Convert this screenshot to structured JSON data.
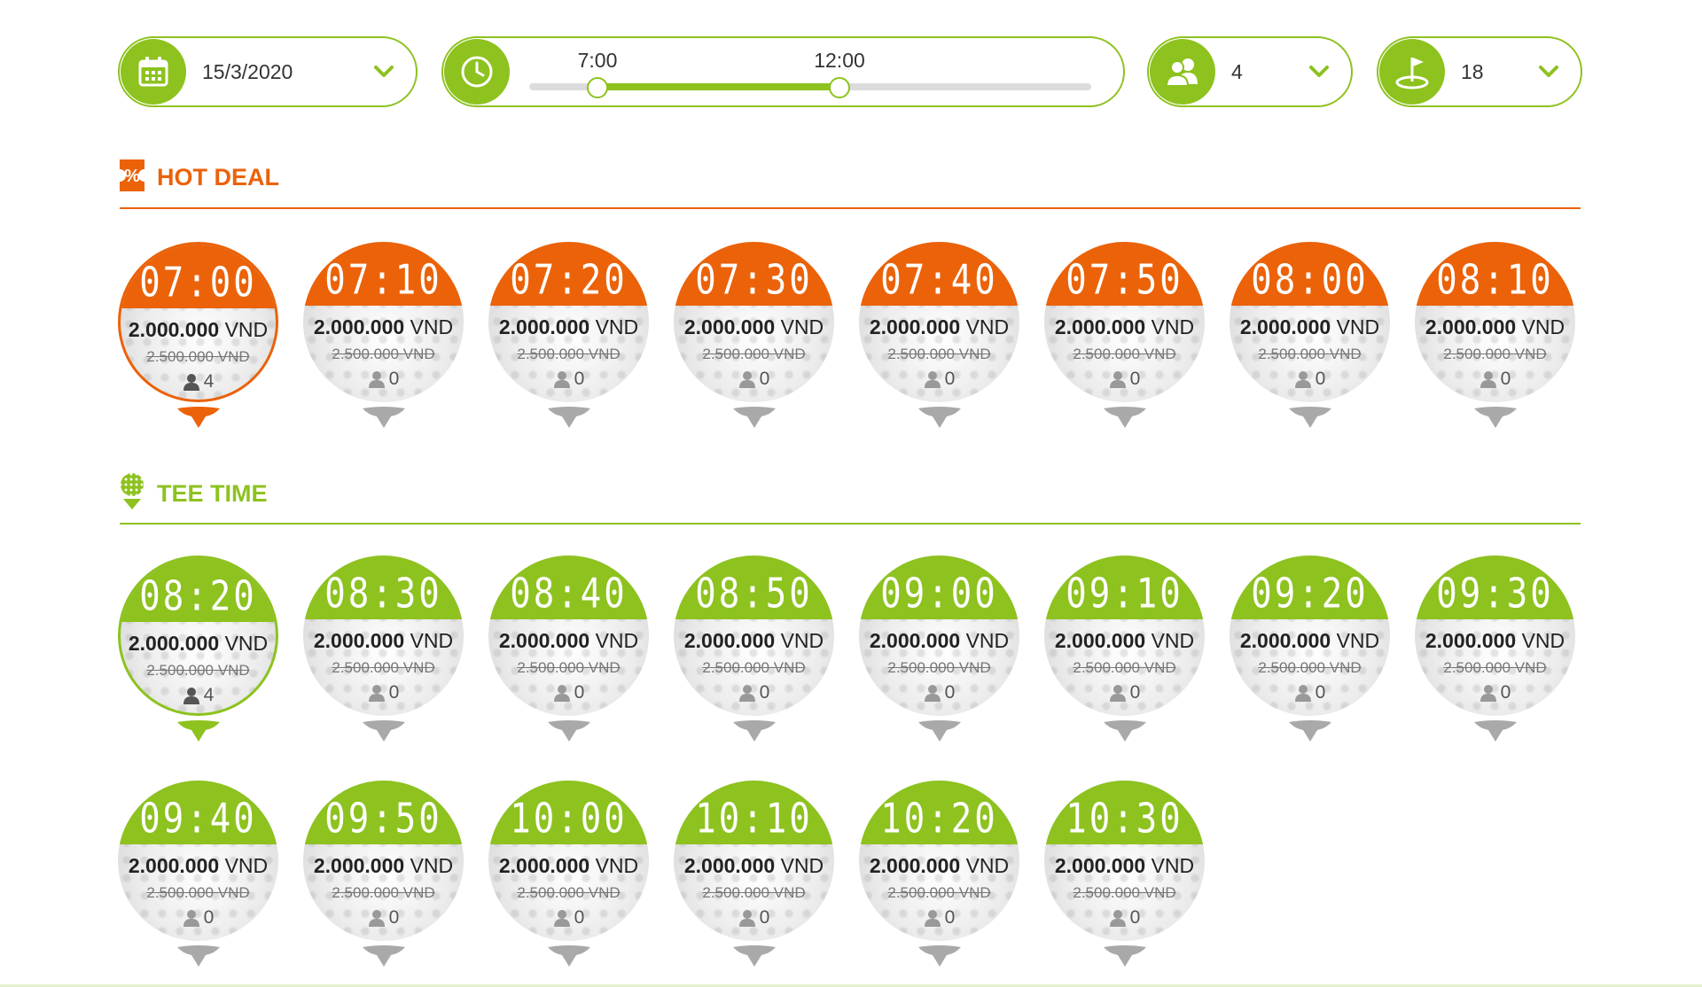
{
  "filters": {
    "date": "15/3/2020",
    "time_from": "7:00",
    "time_to": "12:00",
    "players": "4",
    "holes": "18"
  },
  "hot_deal": {
    "title": "HOT DEAL",
    "color": "#eb6209",
    "slots": [
      {
        "time": "07:00",
        "price": "2.000.000",
        "currency": "VND",
        "old_price": "2.500.000 VND",
        "players": "4",
        "selected": true
      },
      {
        "time": "07:10",
        "price": "2.000.000",
        "currency": "VND",
        "old_price": "2.500.000 VND",
        "players": "0",
        "selected": false
      },
      {
        "time": "07:20",
        "price": "2.000.000",
        "currency": "VND",
        "old_price": "2.500.000 VND",
        "players": "0",
        "selected": false
      },
      {
        "time": "07:30",
        "price": "2.000.000",
        "currency": "VND",
        "old_price": "2.500.000 VND",
        "players": "0",
        "selected": false
      },
      {
        "time": "07:40",
        "price": "2.000.000",
        "currency": "VND",
        "old_price": "2.500.000 VND",
        "players": "0",
        "selected": false
      },
      {
        "time": "07:50",
        "price": "2.000.000",
        "currency": "VND",
        "old_price": "2.500.000 VND",
        "players": "0",
        "selected": false
      },
      {
        "time": "08:00",
        "price": "2.000.000",
        "currency": "VND",
        "old_price": "2.500.000 VND",
        "players": "0",
        "selected": false
      },
      {
        "time": "08:10",
        "price": "2.000.000",
        "currency": "VND",
        "old_price": "2.500.000 VND",
        "players": "0",
        "selected": false
      }
    ]
  },
  "tee_time": {
    "title": "TEE TIME",
    "color": "#8dc21f",
    "slots": [
      {
        "time": "08:20",
        "price": "2.000.000",
        "currency": "VND",
        "old_price": "2.500.000 VND",
        "players": "4",
        "selected": true
      },
      {
        "time": "08:30",
        "price": "2.000.000",
        "currency": "VND",
        "old_price": "2.500.000 VND",
        "players": "0",
        "selected": false
      },
      {
        "time": "08:40",
        "price": "2.000.000",
        "currency": "VND",
        "old_price": "2.500.000 VND",
        "players": "0",
        "selected": false
      },
      {
        "time": "08:50",
        "price": "2.000.000",
        "currency": "VND",
        "old_price": "2.500.000 VND",
        "players": "0",
        "selected": false
      },
      {
        "time": "09:00",
        "price": "2.000.000",
        "currency": "VND",
        "old_price": "2.500.000 VND",
        "players": "0",
        "selected": false
      },
      {
        "time": "09:10",
        "price": "2.000.000",
        "currency": "VND",
        "old_price": "2.500.000 VND",
        "players": "0",
        "selected": false
      },
      {
        "time": "09:20",
        "price": "2.000.000",
        "currency": "VND",
        "old_price": "2.500.000 VND",
        "players": "0",
        "selected": false
      },
      {
        "time": "09:30",
        "price": "2.000.000",
        "currency": "VND",
        "old_price": "2.500.000 VND",
        "players": "0",
        "selected": false
      },
      {
        "time": "09:40",
        "price": "2.000.000",
        "currency": "VND",
        "old_price": "2.500.000 VND",
        "players": "0",
        "selected": false
      },
      {
        "time": "09:50",
        "price": "2.000.000",
        "currency": "VND",
        "old_price": "2.500.000 VND",
        "players": "0",
        "selected": false
      },
      {
        "time": "10:00",
        "price": "2.000.000",
        "currency": "VND",
        "old_price": "2.500.000 VND",
        "players": "0",
        "selected": false
      },
      {
        "time": "10:10",
        "price": "2.000.000",
        "currency": "VND",
        "old_price": "2.500.000 VND",
        "players": "0",
        "selected": false
      },
      {
        "time": "10:20",
        "price": "2.000.000",
        "currency": "VND",
        "old_price": "2.500.000 VND",
        "players": "0",
        "selected": false
      },
      {
        "time": "10:30",
        "price": "2.000.000",
        "currency": "VND",
        "old_price": "2.500.000 VND",
        "players": "0",
        "selected": false
      }
    ]
  },
  "icons": {
    "date": "calendar-icon",
    "time": "clock-icon",
    "players": "people-icon",
    "holes": "golf-flag-icon",
    "hot_deal": "discount-ticket-icon",
    "tee_time": "golf-ball-on-tee-icon",
    "dropdown": "chevron-down-icon",
    "slot_players": "person-icon"
  }
}
